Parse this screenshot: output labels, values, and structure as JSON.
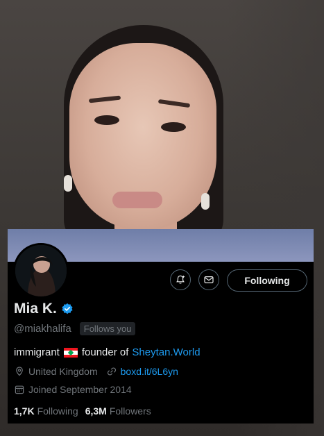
{
  "profile": {
    "name": "Mia K.",
    "handle": "@miakhalifa",
    "follows_you": "Follows you",
    "bio_prefix": "immigrant",
    "bio_middle": "founder of",
    "bio_link": "Sheytan.World",
    "location": "United Kingdom",
    "website": "boxd.it/6L6yn",
    "joined": "Joined September 2014",
    "following_count": "1,7K",
    "following_label": "Following",
    "followers_count": "6,3M",
    "followers_label": "Followers"
  },
  "actions": {
    "follow_button": "Following"
  },
  "icons": {
    "notify": "bell-plus-icon",
    "message": "envelope-icon",
    "verified": "verified-badge-icon",
    "location": "location-pin-icon",
    "link": "link-icon",
    "calendar": "calendar-icon",
    "flag": "lebanon-flag-icon"
  },
  "colors": {
    "card_bg": "#000000",
    "primary_text": "#e7e9ea",
    "secondary_text": "#71767b",
    "accent_blue": "#1d9bf0",
    "banner": "#8c96bd"
  }
}
